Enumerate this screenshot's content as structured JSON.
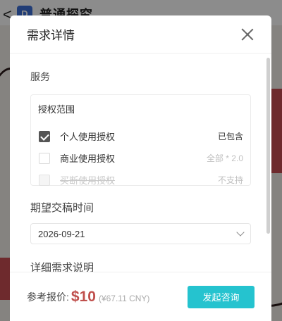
{
  "background": {
    "back_glyph": "<",
    "logo_glyph": "D",
    "title": "普通探究"
  },
  "modal": {
    "title": "需求详情",
    "close_icon": "close-icon",
    "service_label": "服务",
    "scope": {
      "title": "授权范围",
      "options": [
        {
          "label": "个人使用授权",
          "value": "已包含",
          "checked": true,
          "disabled": false
        },
        {
          "label": "商业使用授权",
          "value": "全部 * 2.0",
          "checked": false,
          "disabled": false
        },
        {
          "label": "买断使用授权",
          "value": "不支持",
          "checked": false,
          "disabled": true
        }
      ]
    },
    "deadline_label": "期望交稿时间",
    "deadline_value": "2026-09-21",
    "detail_label": "详细需求说明",
    "footer": {
      "price_label": "参考报价:",
      "price": "$10",
      "price_converted": "(¥67.11 CNY)",
      "consult_button": "发起咨询"
    }
  },
  "colors": {
    "accent": "#25c3cf",
    "price": "#c0504d",
    "checkbox_checked": "#555555"
  }
}
